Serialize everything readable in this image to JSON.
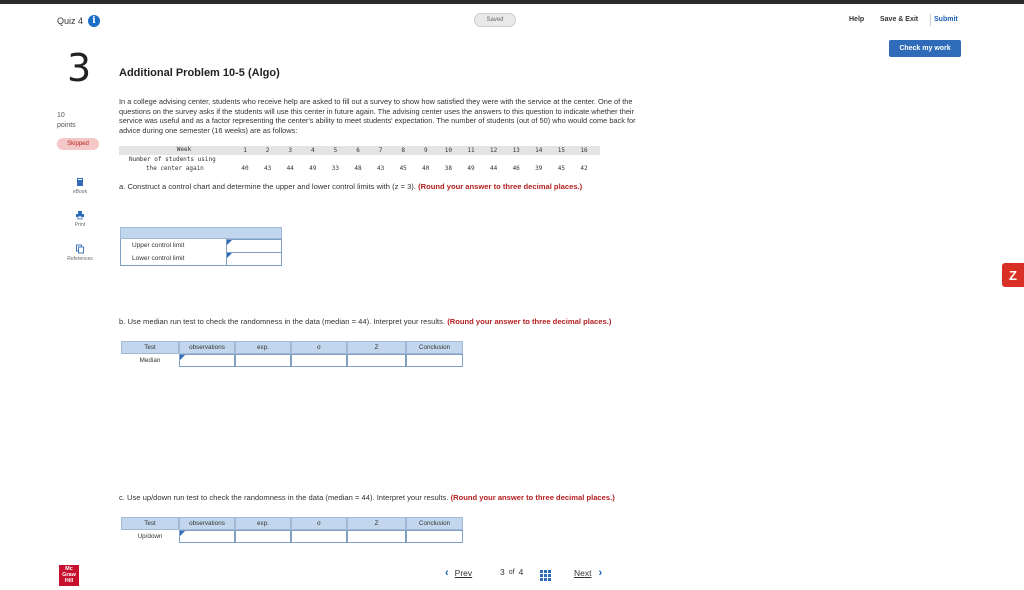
{
  "header": {
    "quiz_title": "Quiz 4",
    "saved_label": "Saved",
    "help_label": "Help",
    "save_exit_label": "Save & Exit",
    "submit_label": "Submit",
    "check_work_label": "Check my work"
  },
  "question": {
    "number": "3",
    "points_value": "10",
    "points_label": "points",
    "status_badge": "Skipped",
    "title": "Additional Problem 10-5 (Algo)",
    "paragraph": "In a college advising center, students who receive help are asked to fill out a survey to show how satisfied they were with the service at the center. One of the questions on the survey asks if the students will use this center in future again. The advising center uses the answers to this question to indicate whether their service was useful and as a factor representing the center's ability to meet students' expectation. The number of students (out of 50) who would come back for advice during one semester (16 weeks) are as follows:"
  },
  "tools": {
    "ebook_label": "eBook",
    "print_label": "Print",
    "references_label": "References"
  },
  "data_table": {
    "week_label": "Week",
    "row_label_line1": "Number of students using",
    "row_label_line2": "the center again",
    "weeks": [
      "1",
      "2",
      "3",
      "4",
      "5",
      "6",
      "7",
      "8",
      "9",
      "10",
      "11",
      "12",
      "13",
      "14",
      "15",
      "16"
    ],
    "values": [
      "40",
      "43",
      "44",
      "49",
      "33",
      "48",
      "43",
      "45",
      "40",
      "38",
      "49",
      "44",
      "46",
      "39",
      "45",
      "42"
    ]
  },
  "part_a": {
    "text": "a. Construct a control chart and determine the upper and lower control limits with (z = 3).",
    "instruction": "(Round your answer to three decimal places.)",
    "rows": [
      "Upper control limit",
      "Lower control limit"
    ]
  },
  "part_b": {
    "text": "b. Use median run test to check the randomness in the data (median = 44). Interpret your results.",
    "instruction": "(Round your answer to three decimal places.)",
    "headers": [
      "Test",
      "observations",
      "exp.",
      "σ",
      "Z",
      "Conclusion"
    ],
    "row_label": "Median"
  },
  "part_c": {
    "text": "c. Use up/down run test to check the randomness in the data (median = 44). Interpret your results.",
    "instruction": "(Round your answer to three decimal places.)",
    "headers": [
      "Test",
      "observations",
      "exp.",
      "σ",
      "Z",
      "Conclusion"
    ],
    "row_label": "Up/down"
  },
  "footer": {
    "prev_label": "Prev",
    "page_current": "3",
    "page_of": "of",
    "page_total": "4",
    "next_label": "Next",
    "logo_line1": "Mc",
    "logo_line2": "Graw",
    "logo_line3": "Hill"
  },
  "colors": {
    "accent": "#2f6bb8",
    "instruction_red": "#b52020",
    "table_header": "#c2d7ee"
  }
}
